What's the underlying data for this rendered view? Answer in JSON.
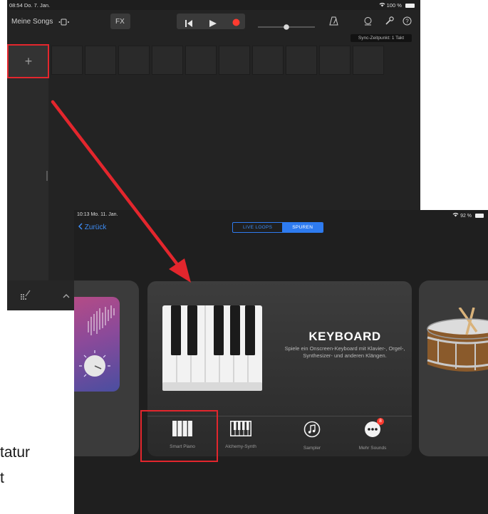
{
  "background_doc": {
    "line1": "tatur",
    "line2": "t"
  },
  "screen_songs": {
    "status_time": "08:54  Do. 7. Jan.",
    "status_battery": "100 %",
    "my_songs": "Meine Songs",
    "fx": "FX",
    "sync_label": "Sync-Zeitpunkt: 1 Takt",
    "add_track": "+",
    "cell_count": 10
  },
  "screen_browser": {
    "status_time": "10:13  Mo. 11. Jan.",
    "status_battery": "92 %",
    "back_label": "Zurück",
    "tabs": [
      {
        "label": "LIVE LOOPS",
        "active": false
      },
      {
        "label": "SPUREN",
        "active": true
      }
    ],
    "keyboard": {
      "title": "KEYBOARD",
      "description": "Spiele ein Onscreen-Keyboard mit Klavier-, Orgel-, Synthesizer- und anderen Klängen."
    },
    "instruments": [
      {
        "label": "Smart Piano",
        "icon": "smart-piano-icon"
      },
      {
        "label": "Alchemy-Synth",
        "icon": "keyboard-icon"
      },
      {
        "label": "Sampler",
        "icon": "sampler-icon"
      },
      {
        "label": "Mehr Sounds",
        "icon": "more-sounds-icon",
        "badge": "8"
      }
    ],
    "page_dots": 11,
    "active_dot": 0
  },
  "colors": {
    "accent_blue": "#2e7bf0",
    "highlight_red": "#e3262d",
    "record_red": "#ff3b30"
  }
}
